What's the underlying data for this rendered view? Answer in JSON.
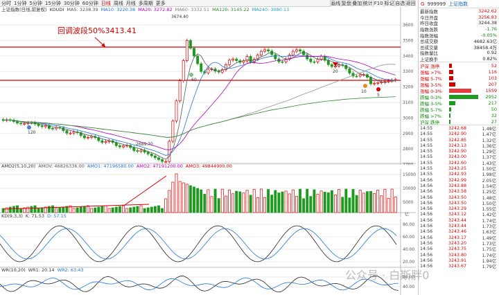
{
  "toolbar": {
    "periods": [
      "分时",
      "1分钟",
      "5分钟",
      "15分钟",
      "30分钟",
      "60分钟",
      "日线",
      "周线",
      "月线",
      "多周期",
      "更多"
    ],
    "active_period": "日线",
    "right_buttons": [
      "画线",
      "复盘",
      "叠加",
      "统计",
      "F10",
      "标记",
      "自选",
      "返回"
    ]
  },
  "main": {
    "title": "上证指数(日线,前复权)",
    "indicator": "KOUDI",
    "ma5": "MA5: 3238.39",
    "ma10": "MA10: 3220.38",
    "ma20": "MA20: 3272.82",
    "ma60": "MA60: 3332.51",
    "ma120": "MA120: 3145.22",
    "ma240": "MA240: 3080.13",
    "annotation": "回调波段50%3413.41",
    "high_label": "3674.40",
    "low_label": "2689.70",
    "marker_120": "120",
    "marker_60": "60",
    "marker_20": "20",
    "marker_10": "10",
    "marker_5": "5",
    "y_ticks": [
      "3600",
      "3500",
      "3400",
      "3300",
      "3200",
      "3100",
      "3000",
      "2900",
      "2800",
      "2700"
    ]
  },
  "amo": {
    "title": "AMO2(5,10,20)",
    "amov": "AMOV: 46826336.00",
    "amo1": "AMO1: 47196580.00",
    "amo2": "AMO2: 47191200.00",
    "amo3": "AMO3: 49844900.00",
    "y_ticks": [
      "15000",
      "10000",
      "5000"
    ],
    "unit": "亿"
  },
  "kd": {
    "title": "KD(9,3,3)",
    "k": "K: 71.53",
    "d": "D: 57.15",
    "y_ticks": [
      "80.00",
      "60.00",
      "40.00",
      "20.00"
    ]
  },
  "wr": {
    "title": "WR(10,20)",
    "wr1": "WR1: 20.14",
    "wr2": "WR2: 63.43",
    "y_ticks": [
      "80.00",
      "40.00"
    ]
  },
  "quote": {
    "g": "G",
    "code": "999999",
    "name": "上证指数",
    "rows": [
      {
        "label": "最新指数",
        "value": "3242.62",
        "cls": "red"
      },
      {
        "label": "今日开盘",
        "value": "3256.83",
        "cls": "red"
      },
      {
        "label": "昨日收盘",
        "value": "3244.38",
        "cls": ""
      },
      {
        "label": "指数涨跌",
        "value": "-1.76",
        "cls": "green"
      },
      {
        "label": "指数涨幅",
        "value": "-0.05%",
        "cls": "green"
      },
      {
        "label": "总成交额",
        "value": "4682.63亿",
        "cls": ""
      },
      {
        "label": "总成交量",
        "value": "38458.4万",
        "cls": ""
      },
      {
        "label": "指数量比",
        "value": "0.92",
        "cls": ""
      },
      {
        "label": "上证换手",
        "value": "0.82%",
        "cls": ""
      }
    ],
    "breadth": [
      {
        "label": "沪深 涨停",
        "num": "52",
        "cls": "red",
        "w": 4,
        "color": "#d40000"
      },
      {
        "label": "涨幅 >7%",
        "num": "116",
        "cls": "red",
        "w": 6,
        "color": "#d40000"
      },
      {
        "label": "涨幅 5-7%",
        "num": "103",
        "cls": "red",
        "w": 6,
        "color": "#d40000"
      },
      {
        "label": "涨幅 3-5%",
        "num": "207",
        "cls": "red",
        "w": 9,
        "color": "#d40000"
      },
      {
        "label": "涨幅 0-3%",
        "num": "1559",
        "cls": "red",
        "w": 32,
        "color": "#e24040"
      },
      {
        "label": "跌幅 0-3%",
        "num": "2952",
        "cls": "green",
        "w": 42,
        "color": "#1e9a1e"
      },
      {
        "label": "跌幅 3-5%",
        "num": "217",
        "cls": "green",
        "w": 9,
        "color": "#1e9a1e"
      },
      {
        "label": "跌幅 5-7%",
        "num": "50",
        "cls": "green",
        "w": 3,
        "color": "#1e9a1e"
      },
      {
        "label": "跌幅 >7%",
        "num": "32",
        "cls": "green",
        "w": 2,
        "color": "#1e9a1e"
      },
      {
        "label": "沪深 跌停",
        "num": "27",
        "cls": "green",
        "w": 2,
        "color": "#1e9a1e"
      }
    ],
    "ticks": [
      {
        "t": "14:55",
        "p": "3242.68",
        "v": "1.48亿"
      },
      {
        "t": "14:55",
        "p": "3242.90",
        "v": "1.47亿"
      },
      {
        "t": "14:55",
        "p": "3242.85",
        "v": "1.32亿"
      },
      {
        "t": "14:55",
        "p": "3243.13",
        "v": "1.36亿"
      },
      {
        "t": "14:55",
        "p": "3242.90",
        "v": "1.29亿"
      },
      {
        "t": "14:55",
        "p": "3243.00",
        "v": "1.37亿"
      },
      {
        "t": "14:55",
        "p": "3242.60",
        "v": "1.43亿"
      },
      {
        "t": "14:55",
        "p": "3243.25",
        "v": "1.50亿"
      },
      {
        "t": "14:55",
        "p": "3242.93",
        "v": "1.98亿"
      },
      {
        "t": "14:56",
        "p": "3242.99",
        "v": "2.05亿"
      },
      {
        "t": "14:56",
        "p": "3243.88",
        "v": "1.54亿"
      },
      {
        "t": "14:56",
        "p": "3243.58",
        "v": "1.25亿"
      },
      {
        "t": "14:56",
        "p": "3243.50",
        "v": "1.48亿"
      },
      {
        "t": "14:56",
        "p": "3243.50",
        "v": "1.50亿"
      },
      {
        "t": "14:56",
        "p": "3243.29",
        "v": "1.55亿"
      },
      {
        "t": "14:56",
        "p": "3243.12",
        "v": "1.42亿"
      },
      {
        "t": "14:56",
        "p": "3243.44",
        "v": "1.74亿"
      },
      {
        "t": "14:56",
        "p": "3243.44",
        "v": "1.73亿"
      },
      {
        "t": "14:56",
        "p": "3243.46",
        "v": "1.63亿"
      },
      {
        "t": "14:56",
        "p": "3243.17",
        "v": "1.49亿"
      },
      {
        "t": "14:56",
        "p": "3243.20",
        "v": "1.73亿"
      },
      {
        "t": "14:56",
        "p": "3243.75",
        "v": "1.75亿"
      },
      {
        "t": "14:56",
        "p": "3243.80",
        "v": "1.74亿"
      },
      {
        "t": "14:56",
        "p": "3243.91",
        "v": "1.94亿"
      },
      {
        "t": "14:56",
        "p": "3243.67",
        "v": "1.79亿"
      }
    ]
  },
  "watermark": "公众号 · 白斯胖0"
}
